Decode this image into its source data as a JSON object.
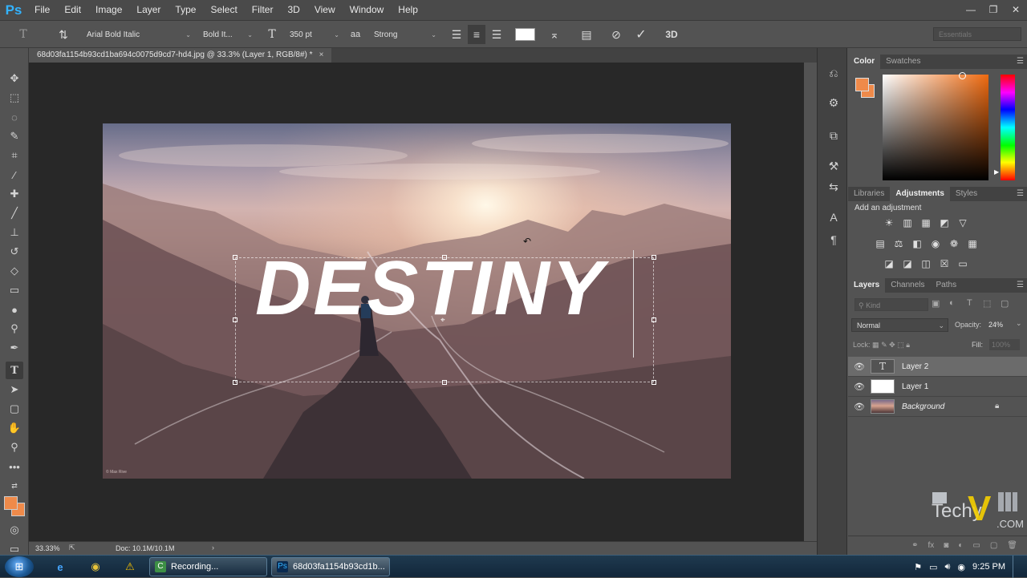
{
  "app": {
    "logo": "Ps"
  },
  "menu": [
    "File",
    "Edit",
    "Image",
    "Layer",
    "Type",
    "Select",
    "Filter",
    "3D",
    "View",
    "Window",
    "Help"
  ],
  "window_controls": {
    "minimize": "—",
    "restore": "❐",
    "close": "✕"
  },
  "options": {
    "font_family": "Arial Bold Italic",
    "font_style": "Bold It...",
    "font_size": "350 pt",
    "aa_label": "aa",
    "antialias": "Strong",
    "workspace": "Essentials"
  },
  "document": {
    "tab_title": "68d03fa1154b93cd1ba694c0075d9cd7-hd4.jpg @ 33.3% (Layer 1, RGB/8#) *",
    "close": "×",
    "text": "DESTINY",
    "watermark_small": "© Max Rive"
  },
  "status": {
    "zoom": "33.33%",
    "doc_size": "Doc: 10.1M/10.1M",
    "arrow": "›"
  },
  "colors": {
    "foreground": "#ef8a4a",
    "background": "#ef8a4a",
    "accent": "#33b3ff"
  },
  "panels": {
    "color_tabs": [
      "Color",
      "Swatches"
    ],
    "adjust_tabs": [
      "Libraries",
      "Adjustments",
      "Styles"
    ],
    "adjust_title": "Add an adjustment",
    "layers_tabs": [
      "Layers",
      "Channels",
      "Paths"
    ],
    "kind": "Kind",
    "blend_mode": "Normal",
    "opacity_label": "Opacity:",
    "opacity": "24%",
    "lock_label": "Lock:",
    "fill_label": "Fill:",
    "fill": "100%",
    "layers": [
      {
        "name": "Layer 2",
        "thumb": "T",
        "selected": true
      },
      {
        "name": "Layer 1",
        "thumb": "",
        "selected": false
      },
      {
        "name": "Background",
        "thumb": "",
        "selected": false
      }
    ]
  },
  "taskbar": {
    "recording": "Recording...",
    "ps_window": "68d03fa1154b93cd1b...",
    "time": "9:25 PM"
  },
  "watermark": {
    "brand": "Techy",
    "suffix": ".COM"
  }
}
